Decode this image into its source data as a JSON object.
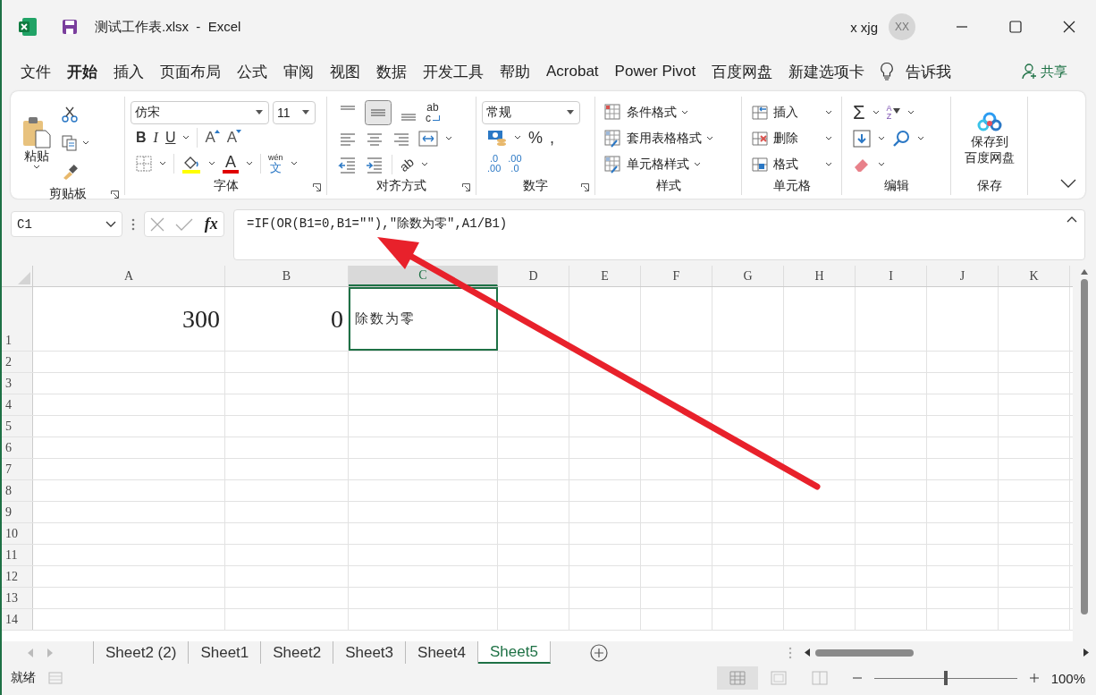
{
  "window": {
    "title": "测试工作表.xlsx  -  Excel",
    "user": "x xjg",
    "avatar": "XX"
  },
  "tabs": [
    {
      "label": "文件",
      "selected": false
    },
    {
      "label": "开始",
      "selected": true
    },
    {
      "label": "插入",
      "selected": false
    },
    {
      "label": "页面布局",
      "selected": false
    },
    {
      "label": "公式",
      "selected": false
    },
    {
      "label": "审阅",
      "selected": false
    },
    {
      "label": "视图",
      "selected": false
    },
    {
      "label": "数据",
      "selected": false
    },
    {
      "label": "开发工具",
      "selected": false
    },
    {
      "label": "帮助",
      "selected": false
    },
    {
      "label": "Acrobat",
      "selected": false
    },
    {
      "label": "Power Pivot",
      "selected": false
    },
    {
      "label": "百度网盘",
      "selected": false
    },
    {
      "label": "新建选项卡",
      "selected": false
    }
  ],
  "tell_me": "告诉我",
  "share": "共享",
  "ribbon": {
    "clipboard": {
      "label": "剪贴板",
      "paste": "粘贴"
    },
    "font": {
      "label": "字体",
      "font": "仿宋",
      "size": "11",
      "style_buttons": [
        "B",
        "I",
        "U"
      ],
      "size_buttons": [
        "A",
        "A"
      ],
      "color_button": "A",
      "phonetic": [
        "wén",
        "文"
      ]
    },
    "alignment": {
      "label": "对齐方式",
      "wrap": [
        "ab",
        "c"
      ],
      "orientation": "ab"
    },
    "number": {
      "label": "数字",
      "format": "常规",
      "symbols": [
        "%",
        ","
      ],
      "decimals": [
        [
          ".0",
          ".00"
        ],
        [
          ".00",
          ".0"
        ]
      ]
    },
    "styles": {
      "label": "样式",
      "items": [
        "条件格式",
        "套用表格格式",
        "单元格样式"
      ]
    },
    "cells": {
      "label": "单元格",
      "items": [
        "插入",
        "删除",
        "格式"
      ]
    },
    "editing": {
      "label": "编辑",
      "autosum": "Σ",
      "sort": [
        "A",
        "Z"
      ]
    },
    "save": {
      "label": "保存",
      "button": [
        "保存到",
        "百度网盘"
      ]
    }
  },
  "formula_bar": {
    "name_box": "C1",
    "fx": "fx",
    "formula": "=IF(OR(B1=0,B1=\"\"),\"除数为零\",A1/B1)"
  },
  "columns": [
    {
      "label": "A",
      "selected": false
    },
    {
      "label": "B",
      "selected": false
    },
    {
      "label": "C",
      "selected": true
    },
    {
      "label": "D",
      "selected": false
    },
    {
      "label": "E",
      "selected": false
    },
    {
      "label": "F",
      "selected": false
    },
    {
      "label": "G",
      "selected": false
    },
    {
      "label": "H",
      "selected": false
    },
    {
      "label": "I",
      "selected": false
    },
    {
      "label": "J",
      "selected": false
    },
    {
      "label": "K",
      "selected": false
    }
  ],
  "rows": [
    {
      "label": "1",
      "cells": [
        {
          "text": "300",
          "kind": "number",
          "selected": false
        },
        {
          "text": "0",
          "kind": "number",
          "selected": false
        },
        {
          "text": "除数为零",
          "kind": "text",
          "selected": true
        }
      ]
    },
    {
      "label": "2"
    },
    {
      "label": "3"
    },
    {
      "label": "4"
    },
    {
      "label": "5"
    },
    {
      "label": "6"
    },
    {
      "label": "7"
    },
    {
      "label": "8"
    },
    {
      "label": "9"
    },
    {
      "label": "10"
    },
    {
      "label": "11"
    },
    {
      "label": "12"
    },
    {
      "label": "13"
    },
    {
      "label": "14"
    }
  ],
  "sheets": [
    {
      "label": "Sheet2 (2)",
      "selected": false
    },
    {
      "label": "Sheet1",
      "selected": false
    },
    {
      "label": "Sheet2",
      "selected": false
    },
    {
      "label": "Sheet3",
      "selected": false
    },
    {
      "label": "Sheet4",
      "selected": false
    },
    {
      "label": "Sheet5",
      "selected": true
    }
  ],
  "status_bar": {
    "status": "就绪",
    "zoom": "100%",
    "zoom_slider": {
      "level": 0.5
    }
  }
}
